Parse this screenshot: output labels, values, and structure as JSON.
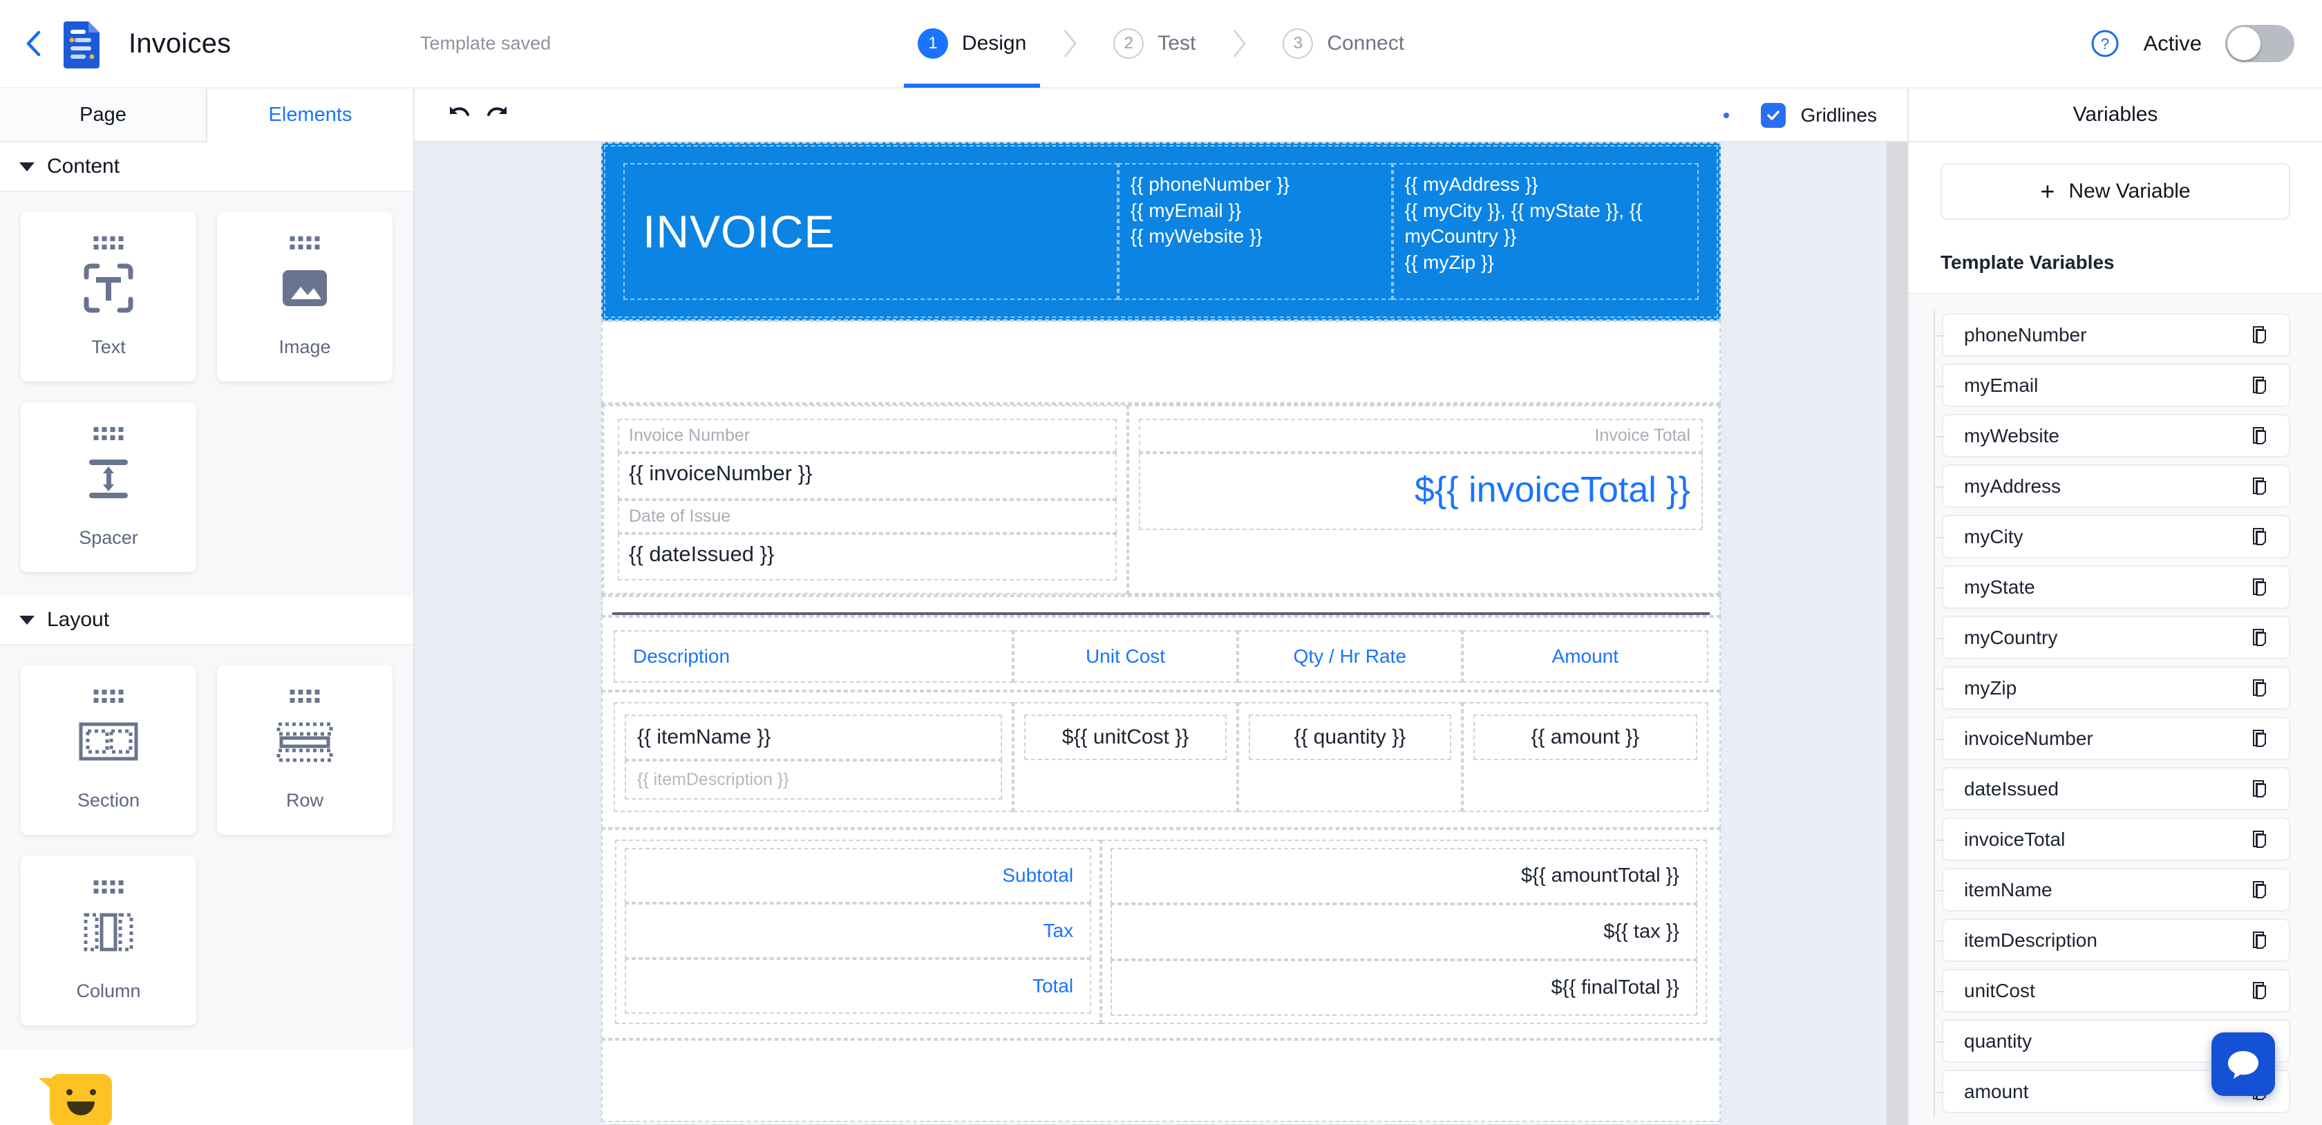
{
  "topbar": {
    "back_icon": "chevron-left-icon",
    "logo_icon": "document-logo-icon",
    "title": "Invoices",
    "save_status": "Template saved",
    "steps": [
      {
        "number": "1",
        "label": "Design",
        "state": "active"
      },
      {
        "number": "2",
        "label": "Test",
        "state": "inactive"
      },
      {
        "number": "3",
        "label": "Connect",
        "state": "inactive"
      }
    ],
    "help_icon": "help-circle-icon",
    "active_label": "Active",
    "toggle_state": "off"
  },
  "left_panel": {
    "tabs": [
      {
        "label": "Page",
        "active": false
      },
      {
        "label": "Elements",
        "active": true
      }
    ],
    "groups": [
      {
        "title": "Content",
        "items": [
          {
            "label": "Text",
            "icon": "text-element-icon"
          },
          {
            "label": "Image",
            "icon": "image-element-icon"
          },
          {
            "label": "Spacer",
            "icon": "spacer-element-icon"
          }
        ]
      },
      {
        "title": "Layout",
        "items": [
          {
            "label": "Section",
            "icon": "section-element-icon"
          },
          {
            "label": "Row",
            "icon": "row-element-icon"
          },
          {
            "label": "Column",
            "icon": "column-element-icon"
          }
        ]
      }
    ]
  },
  "toolbar": {
    "undo_icon": "undo-icon",
    "redo_icon": "redo-icon",
    "gridlines_label": "Gridlines",
    "gridlines_checked": true
  },
  "canvas": {
    "header": {
      "title": "INVOICE",
      "contact_lines": [
        "{{ phoneNumber }}",
        "{{ myEmail }}",
        "{{ myWebsite }}"
      ],
      "address_lines": [
        "{{ myAddress }}",
        "{{ myCity }}, {{ myState }}, {{ myCountry }}",
        "{{ myZip }}"
      ],
      "bg_color": "#0b84e4"
    },
    "meta": {
      "invoice_number_label": "Invoice Number",
      "invoice_number_value": "{{ invoiceNumber }}",
      "date_issued_label": "Date of Issue",
      "date_issued_value": "{{ dateIssued }}",
      "invoice_total_label": "Invoice Total",
      "invoice_total_value": "${{ invoiceTotal }}"
    },
    "table": {
      "headers": [
        "Description",
        "Unit Cost",
        "Qty / Hr Rate",
        "Amount"
      ],
      "row": {
        "item_name": "{{ itemName }}",
        "item_description": "{{ itemDescription }}",
        "unit_cost": "${{ unitCost }}",
        "quantity": "{{ quantity }}",
        "amount": "{{ amount }}"
      }
    },
    "totals": [
      {
        "label": "Subtotal",
        "value": "${{ amountTotal }}"
      },
      {
        "label": "Tax",
        "value": "${{ tax }}"
      },
      {
        "label": "Total",
        "value": "${{ finalTotal }}"
      }
    ]
  },
  "right_panel": {
    "title": "Variables",
    "new_variable_label": "New Variable",
    "section_label": "Template Variables",
    "variables": [
      {
        "name": "phoneNumber"
      },
      {
        "name": "myEmail"
      },
      {
        "name": "myWebsite"
      },
      {
        "name": "myAddress"
      },
      {
        "name": "myCity"
      },
      {
        "name": "myState"
      },
      {
        "name": "myCountry"
      },
      {
        "name": "myZip"
      },
      {
        "name": "invoiceNumber"
      },
      {
        "name": "dateIssued"
      },
      {
        "name": "invoiceTotal"
      },
      {
        "name": "itemName"
      },
      {
        "name": "itemDescription"
      },
      {
        "name": "unitCost"
      },
      {
        "name": "quantity"
      },
      {
        "name": "amount"
      }
    ]
  },
  "widgets": {
    "chat_icon": "chat-bubble-icon",
    "feedback_icon": "smiley-feedback-icon"
  },
  "colors": {
    "accent_blue": "#1a73ff",
    "header_blue": "#0b84e4",
    "chat_blue": "#1551d4",
    "smiley_yellow": "#ffc225"
  }
}
